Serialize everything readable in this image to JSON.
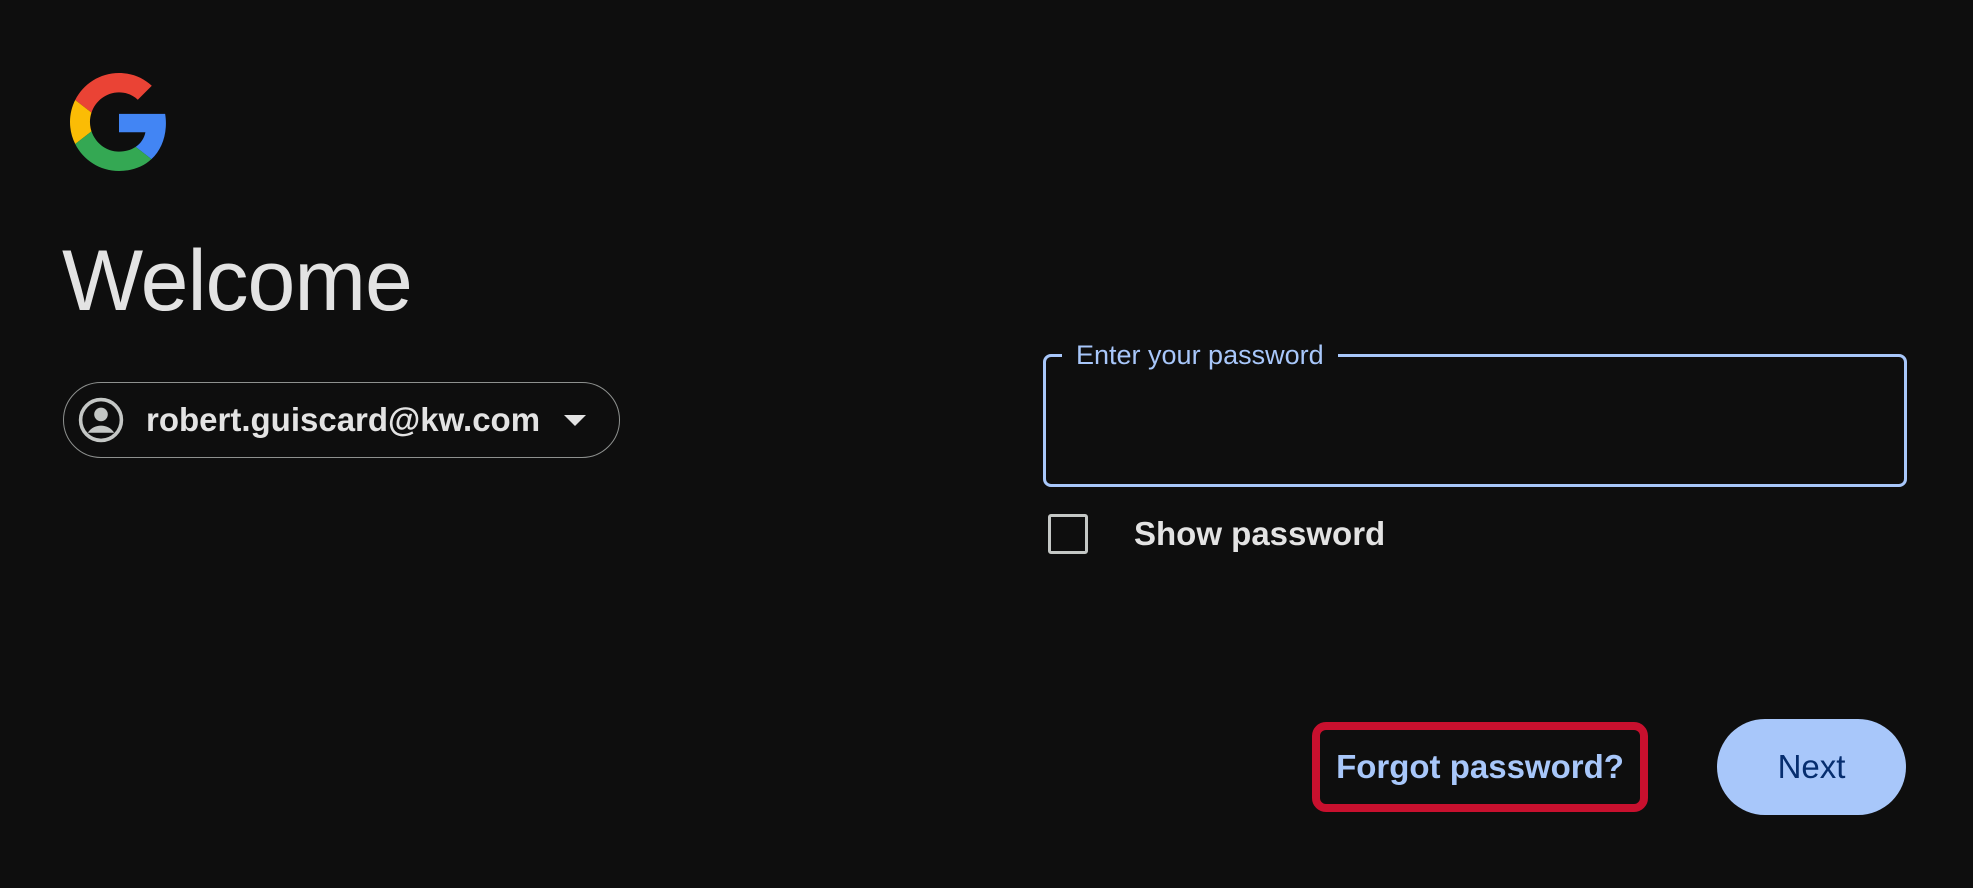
{
  "header": {
    "logo_icon": "google-g-icon",
    "title": "Welcome"
  },
  "account": {
    "avatar_icon": "account-circle-icon",
    "email": "robert.guiscard@kw.com",
    "dropdown_icon": "caret-down-icon"
  },
  "password_field": {
    "label": "Enter your password",
    "value": ""
  },
  "show_password": {
    "label": "Show password",
    "checked": false
  },
  "actions": {
    "forgot_label": "Forgot password?",
    "next_label": "Next"
  },
  "colors": {
    "background": "#0e0e0e",
    "accent": "#a8c7fa",
    "button_text": "#062e6f",
    "highlight": "#c8102e"
  }
}
